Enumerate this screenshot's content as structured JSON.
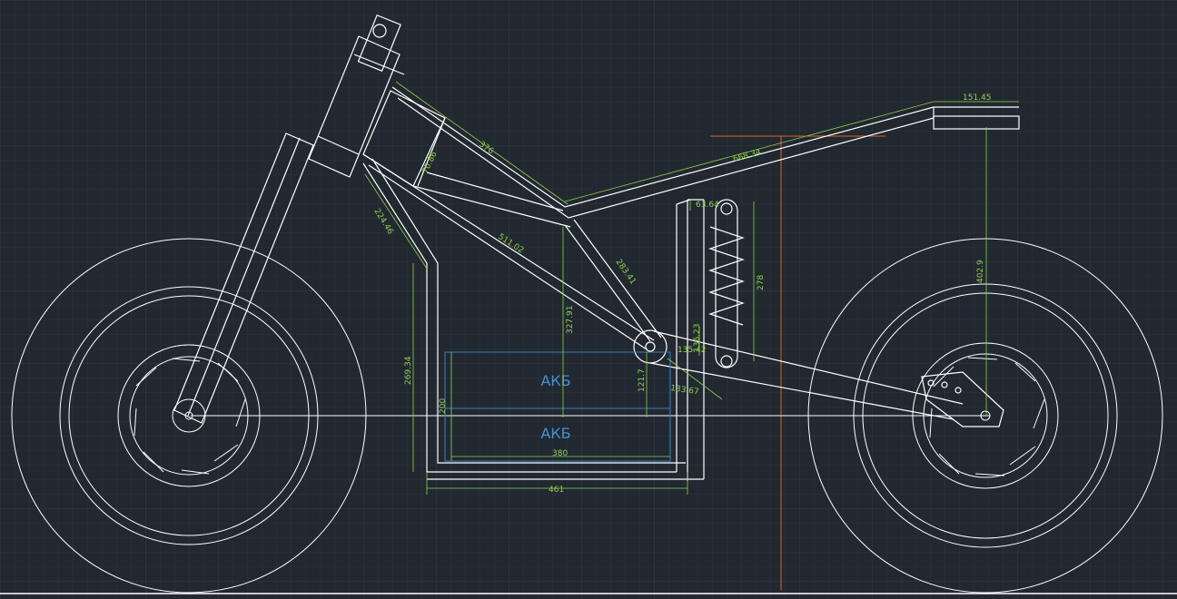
{
  "battery_labels": {
    "upper": "АКБ",
    "lower": "АКБ"
  },
  "dimensions": {
    "rear_rack_length": "151.45",
    "top_tube_length": "668.34",
    "frame_upper_tube": "376",
    "head_tube_gusset": "70.86",
    "front_down_tube": "224.46",
    "main_spar": "511.02",
    "seat_post_length": "283.41",
    "swingarm_to_spar_height": "327.91",
    "shock_top_offset": "63.64",
    "shock_spring_length": "278",
    "pivot_mount_height": "136.23",
    "pivot_mount_offset": "135.42",
    "pivot_axle_height": "121.7",
    "swingarm_offset": "133.67",
    "front_frame_height": "269.34",
    "battery_height": "200",
    "battery_width": "380",
    "frame_bottom_width": "461",
    "rear_axle_height": "402.9"
  },
  "colors": {
    "background": "#212830",
    "grid_minor": "#2a323b",
    "grid_major": "#343d47",
    "drawing_line": "#ffffff",
    "dimension_line": "#8fd14f",
    "battery_outline": "#3d7fc2",
    "reference_line": "#d9622b"
  }
}
